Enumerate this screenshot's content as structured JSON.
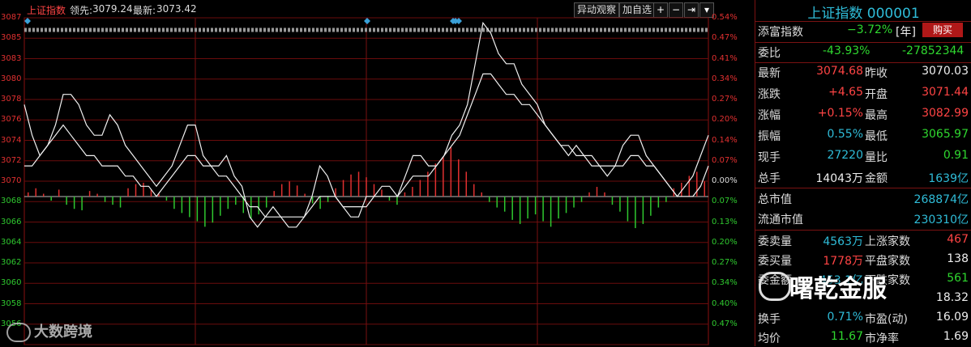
{
  "topbar": {
    "index_name": "上证指数",
    "lead_label": "领先:",
    "lead_value": "3079.24",
    "latest_label": "最新:",
    "latest_value": "3073.42",
    "btn_abnormal": "异动观察",
    "btn_add": "加自选",
    "icon_plus": "+",
    "icon_minus": "−",
    "icon_jump": "⇥",
    "icon_menu": "▾"
  },
  "chart_axis": {
    "left_ticks": [
      "3087",
      "3085",
      "3083",
      "3080",
      "3078",
      "3076",
      "3074",
      "3072",
      "3070",
      "3068",
      "3066",
      "3064",
      "3062",
      "3060",
      "3058",
      "3056"
    ],
    "right_ticks": [
      "0.54%",
      "0.47%",
      "0.41%",
      "0.34%",
      "0.27%",
      "0.20%",
      "0.14%",
      "0.07%",
      "0.00%",
      "0.07%",
      "0.13%",
      "0.20%",
      "0.27%",
      "0.34%",
      "0.40%",
      "0.47%"
    ]
  },
  "chart_data": {
    "type": "line",
    "y_range": [
      3055.5,
      3087.5
    ],
    "series": [
      {
        "values": [
          3079,
          3076,
          3074,
          3075,
          3077,
          3080,
          3080,
          3079,
          3077,
          3076,
          3076,
          3078,
          3077,
          3075,
          3074,
          3073,
          3072,
          3071,
          3072,
          3073,
          3075,
          3077,
          3077,
          3074,
          3073,
          3073,
          3074,
          3072,
          3071,
          3068,
          3067,
          3068,
          3069,
          3068,
          3067,
          3067,
          3068,
          3070,
          3073,
          3072,
          3070,
          3069,
          3068,
          3068,
          3070,
          3070,
          3071,
          3071,
          3070,
          3072,
          3074,
          3074,
          3073,
          3073,
          3074,
          3076,
          3077,
          3079,
          3083,
          3087,
          3086,
          3084,
          3083,
          3083,
          3081,
          3080,
          3079,
          3077,
          3076,
          3075,
          3074,
          3075,
          3074,
          3073,
          3073,
          3072,
          3073,
          3075,
          3076,
          3076,
          3074,
          3073,
          3072,
          3071,
          3070,
          3071,
          3072,
          3074,
          3076
        ]
      },
      {
        "values": [
          3073,
          3073,
          3074,
          3075,
          3076,
          3077,
          3076,
          3075,
          3074,
          3074,
          3073,
          3073,
          3073,
          3072,
          3072,
          3071,
          3071,
          3070,
          3071,
          3072,
          3073,
          3074,
          3074,
          3073,
          3073,
          3072,
          3072,
          3071,
          3070,
          3069,
          3069,
          3068,
          3068,
          3068,
          3068,
          3068,
          3068,
          3069,
          3070,
          3070,
          3070,
          3069,
          3069,
          3069,
          3069,
          3070,
          3070,
          3070,
          3070,
          3071,
          3072,
          3072,
          3072,
          3073,
          3074,
          3075,
          3076,
          3078,
          3080,
          3082,
          3082,
          3081,
          3080,
          3080,
          3079,
          3079,
          3078,
          3077,
          3076,
          3075,
          3075,
          3074,
          3074,
          3074,
          3073,
          3073,
          3073,
          3073,
          3074,
          3074,
          3073,
          3073,
          3072,
          3071,
          3070,
          3070,
          3070,
          3071,
          3073
        ]
      }
    ],
    "volume_bars": [
      0.3,
      0.6,
      0.2,
      -0.3,
      0.5,
      -0.6,
      -0.9,
      -1.0,
      0.4,
      0.2,
      -0.4,
      -0.6,
      -0.8,
      0.6,
      0.9,
      1.0,
      0.5,
      0.2,
      -0.3,
      -0.9,
      -1.2,
      -1.5,
      -1.8,
      -2.2,
      -1.9,
      -1.4,
      -0.9,
      -0.6,
      -1.2,
      -1.6,
      -1.3,
      -0.8,
      0.4,
      0.9,
      1.1,
      0.8,
      0.2,
      -0.5,
      -0.9,
      -0.4,
      0.6,
      1.2,
      1.6,
      1.8,
      1.4,
      0.9,
      0.5,
      -0.3,
      -0.6,
      0.3,
      0.7,
      1.2,
      1.8,
      2.4,
      2.9,
      3.6,
      2.7,
      1.8,
      0.9,
      0.3,
      -0.4,
      -0.8,
      -1.1,
      -1.7,
      -2.0,
      -1.6,
      -1.3,
      -1.8,
      -2.2,
      -1.6,
      -1.2,
      -0.8,
      -0.4,
      0.3,
      0.7,
      0.3,
      -0.6,
      -1.1,
      -1.8,
      -2.3,
      -2.0,
      -1.4,
      -0.8,
      -0.4,
      0.6,
      1.0,
      1.5,
      1.8,
      1.1
    ]
  },
  "watermark_left": "大数跨境",
  "panel": {
    "title": "上证指数 000001",
    "row1": {
      "label": "添富指数",
      "value": "−3.72%",
      "tag": "[年]",
      "buy": "购买"
    },
    "row2": {
      "label": "委比",
      "v1": "-43.93%",
      "v2": "-27852344"
    },
    "quote": [
      {
        "l": "最新",
        "v": "3074.68",
        "l2": "昨收",
        "v2": "3070.03",
        "c1": "red",
        "c2": "wh"
      },
      {
        "l": "涨跌",
        "v": "+4.65",
        "l2": "开盘",
        "v2": "3071.44",
        "c1": "red",
        "c2": "red"
      },
      {
        "l": "涨幅",
        "v": "+0.15%",
        "l2": "最高",
        "v2": "3082.99",
        "c1": "red",
        "c2": "red"
      },
      {
        "l": "振幅",
        "v": "0.55%",
        "l2": "最低",
        "v2": "3065.97",
        "c1": "cy",
        "c2": "grn"
      },
      {
        "l": "现手",
        "v": "27220",
        "l2": "量比",
        "v2": "0.91",
        "c1": "cy",
        "c2": "grn"
      },
      {
        "l": "总手",
        "v": "14043万",
        "l2": "金额",
        "v2": "1639亿",
        "c1": "wh",
        "c2": "cy"
      }
    ],
    "cap": [
      {
        "l": "总市值",
        "v": "268874亿"
      },
      {
        "l": "流通市值",
        "v": "230310亿"
      }
    ],
    "stats": [
      {
        "l": "委卖量",
        "v": "4563万",
        "l2": "上涨家数",
        "v2": "467",
        "c1": "cy",
        "c2": "red"
      },
      {
        "l": "委买量",
        "v": "1778万",
        "l2": "平盘家数",
        "v2": "138",
        "c1": "red",
        "c2": "wh"
      },
      {
        "l": "委金额",
        "v": "453.1亿",
        "l2": "下跌家数",
        "v2": "561",
        "c1": "cy",
        "c2": "grn"
      },
      {
        "l": "",
        "v": "",
        "l2": "",
        "v2": "18.32",
        "c1": "cy",
        "c2": "wh"
      },
      {
        "l": "换手",
        "v": "0.71%",
        "l2": "市盈(动)",
        "v2": "16.09",
        "c1": "cy",
        "c2": "wh"
      },
      {
        "l": "均价",
        "v": "11.67",
        "l2": "市净率",
        "v2": "1.69",
        "c1": "grn",
        "c2": "wh"
      }
    ],
    "watermark": "曙乾金服"
  }
}
